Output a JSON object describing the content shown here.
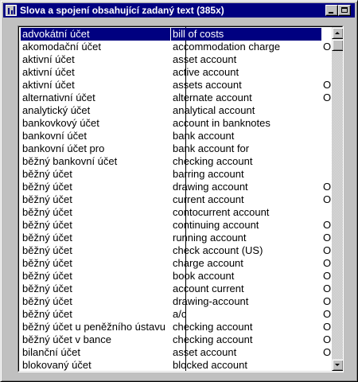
{
  "window": {
    "title": "Slova a spojení obsahující zadaný text (385x)",
    "accent": "#000080"
  },
  "list": {
    "selected_index": 0,
    "rows": [
      {
        "cs": "advokátní účet",
        "en": "bill of costs",
        "flag": ""
      },
      {
        "cs": "akomodační účet",
        "en": "accommodation charge",
        "flag": "O"
      },
      {
        "cs": "aktivní účet",
        "en": "asset account",
        "flag": ""
      },
      {
        "cs": "aktivní účet",
        "en": "active account",
        "flag": ""
      },
      {
        "cs": "aktivní účet",
        "en": "assets account",
        "flag": "O"
      },
      {
        "cs": "alternativní účet",
        "en": "alternate account",
        "flag": "O"
      },
      {
        "cs": "analytický účet",
        "en": "analytical account",
        "flag": ""
      },
      {
        "cs": "bankovkový účet",
        "en": "account in banknotes",
        "flag": ""
      },
      {
        "cs": "bankovní účet",
        "en": "bank account",
        "flag": ""
      },
      {
        "cs": "bankovní účet pro",
        "en": "bank account for",
        "flag": ""
      },
      {
        "cs": "běžný bankovní účet",
        "en": "checking account",
        "flag": ""
      },
      {
        "cs": "běžný účet",
        "en": "barring account",
        "flag": ""
      },
      {
        "cs": "běžný účet",
        "en": "drawing account",
        "flag": "O"
      },
      {
        "cs": "běžný účet",
        "en": "current account",
        "flag": "O"
      },
      {
        "cs": "běžný účet",
        "en": "contocurrent account",
        "flag": ""
      },
      {
        "cs": "běžný účet",
        "en": "continuing account",
        "flag": "O"
      },
      {
        "cs": "běžný účet",
        "en": "running account",
        "flag": "O"
      },
      {
        "cs": "běžný účet",
        "en": "check account (US)",
        "flag": "O"
      },
      {
        "cs": "běžný účet",
        "en": "charge account",
        "flag": "O"
      },
      {
        "cs": "běžný účet",
        "en": "book account",
        "flag": "O"
      },
      {
        "cs": "běžný účet",
        "en": "account current",
        "flag": "O"
      },
      {
        "cs": "běžný účet",
        "en": "drawing-account",
        "flag": "O"
      },
      {
        "cs": "běžný účet",
        "en": "a/c",
        "flag": "O"
      },
      {
        "cs": "běžný účet u peněžního ústavu",
        "en": "checking account",
        "flag": "O"
      },
      {
        "cs": "běžný účet v bance",
        "en": "checking account",
        "flag": "O"
      },
      {
        "cs": "bilanční účet",
        "en": "asset account",
        "flag": "O"
      },
      {
        "cs": "blokovaný účet",
        "en": "blocked account",
        "flag": ""
      }
    ]
  },
  "scroll": {
    "position_fraction": 0.0
  }
}
